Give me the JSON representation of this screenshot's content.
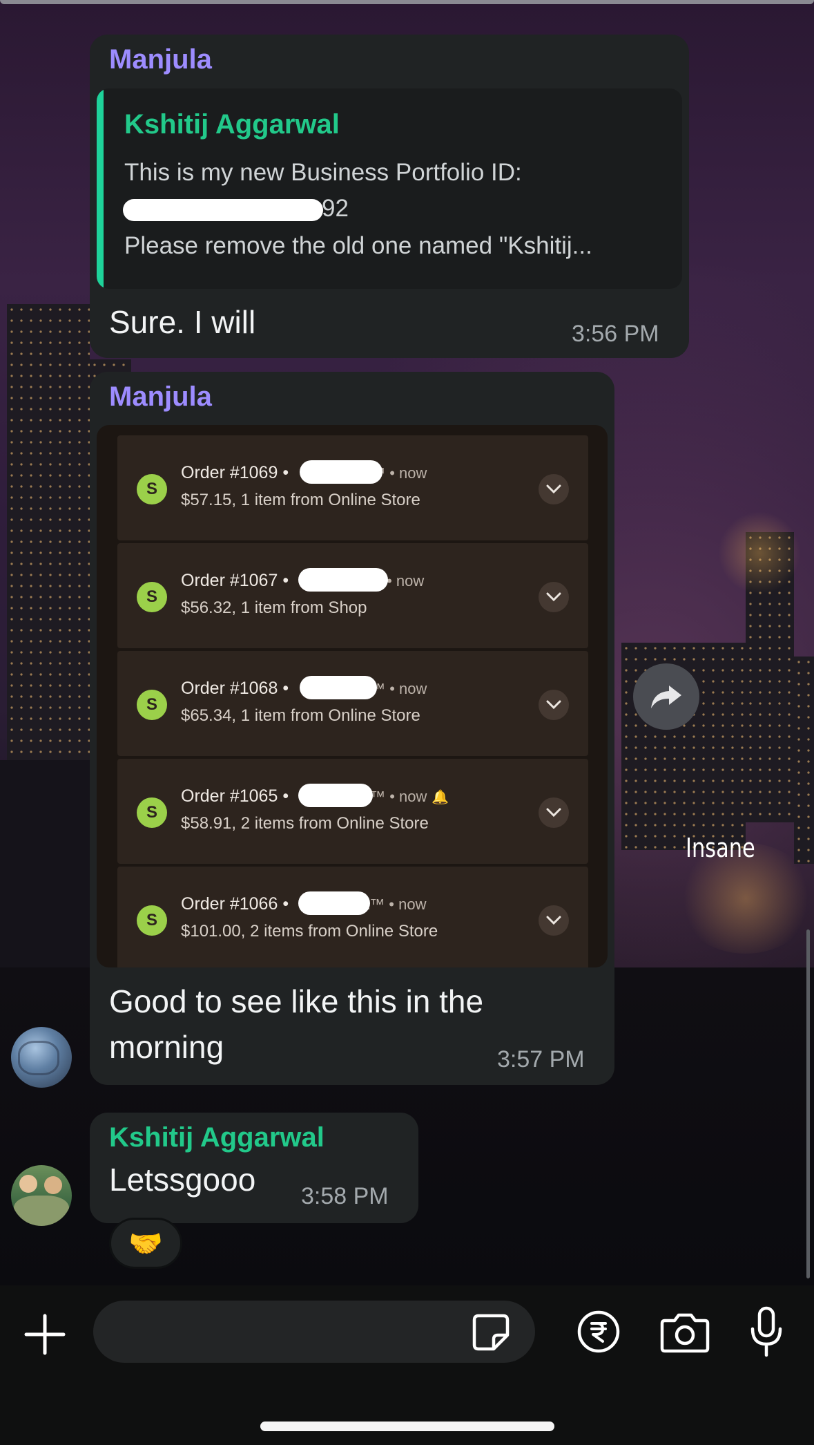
{
  "messages": [
    {
      "sender": "Manjula",
      "sender_color": "#9d8cff",
      "quoted": {
        "author": "Kshitij Aggarwal",
        "line1": "This is my new Business Portfolio ID:",
        "line2_visible": "92",
        "line3": "Please remove the old one named \"Kshitij..."
      },
      "text": "Sure. I will",
      "time": "3:56 PM"
    },
    {
      "sender": "Manjula",
      "sender_color": "#9d8cff",
      "image": {
        "orders": [
          {
            "title": "Order #1069 •",
            "suffix": "™ • now",
            "detail": "$57.15, 1 item from Online Store"
          },
          {
            "title": "Order #1067 •",
            "suffix": "• now",
            "detail": "$56.32, 1 item from Shop"
          },
          {
            "title": "Order #1068 •",
            "suffix": "™ • now",
            "detail": "$65.34, 1 item from Online Store"
          },
          {
            "title": "Order #1065 •",
            "suffix": "™ • now",
            "detail": "$58.91, 2 items from Online Store"
          },
          {
            "title": "Order #1066 •",
            "suffix": "st™ • now",
            "detail": "$101.00, 2 items from Online Store"
          }
        ]
      },
      "text_line1": "Good to see like this in the",
      "text_line2": "morning",
      "time": "3:57 PM"
    },
    {
      "sender": "Kshitij Aggarwal",
      "sender_color": "#22c98a",
      "text": "Letssgooo",
      "time": "3:58 PM",
      "reaction": "🤝"
    }
  ],
  "wallpaper_caption": "Insane",
  "icons": {
    "forward": "forward-arrow-icon",
    "add": "plus-icon",
    "sticker": "sticker-icon",
    "payment": "rupee-icon",
    "camera": "camera-icon",
    "mic": "microphone-icon",
    "order_badge": "shopify-bag-icon",
    "order_expand": "chevron-down-icon"
  },
  "colors": {
    "accent_green": "#22c98a",
    "accent_purple": "#9d8cff",
    "bubble_bg": "#202324"
  }
}
